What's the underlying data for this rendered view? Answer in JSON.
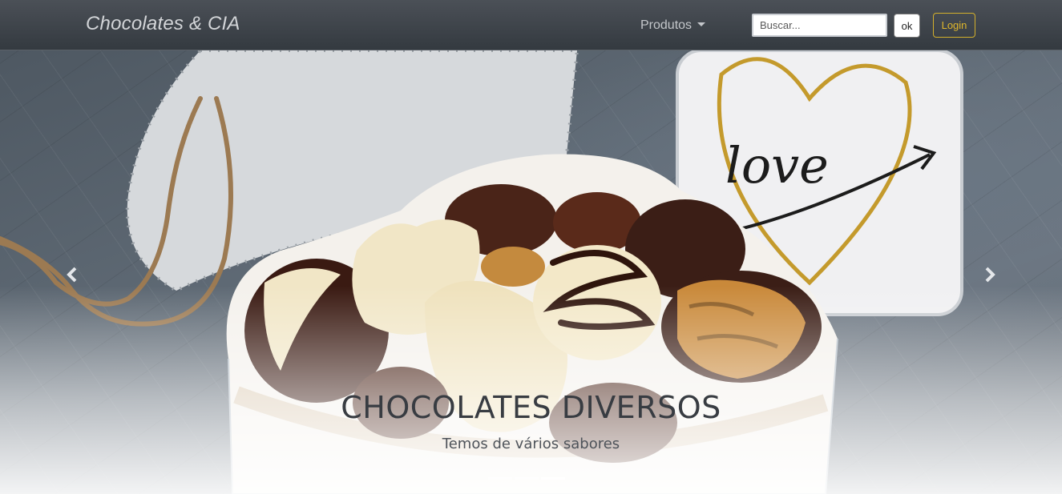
{
  "navbar": {
    "brand": "Chocolates & CIA",
    "dropdown_label": "Produtos",
    "search_placeholder": "Buscar...",
    "ok_label": "ok",
    "login_label": "Login"
  },
  "carousel": {
    "title": "CHOCOLATES DIVERSOS",
    "subtitle": "Temos de vários sabores",
    "slides_count": 3,
    "active_slide": 3,
    "photo_text": "love"
  },
  "colors": {
    "navbar": "#343a40",
    "login_accent": "#d4b02c",
    "chocolate_dark": "#3b1e16",
    "chocolate_white": "#f1e6c6"
  },
  "icons": [
    "chevron-left-icon",
    "chevron-right-icon",
    "caret-down-icon"
  ]
}
